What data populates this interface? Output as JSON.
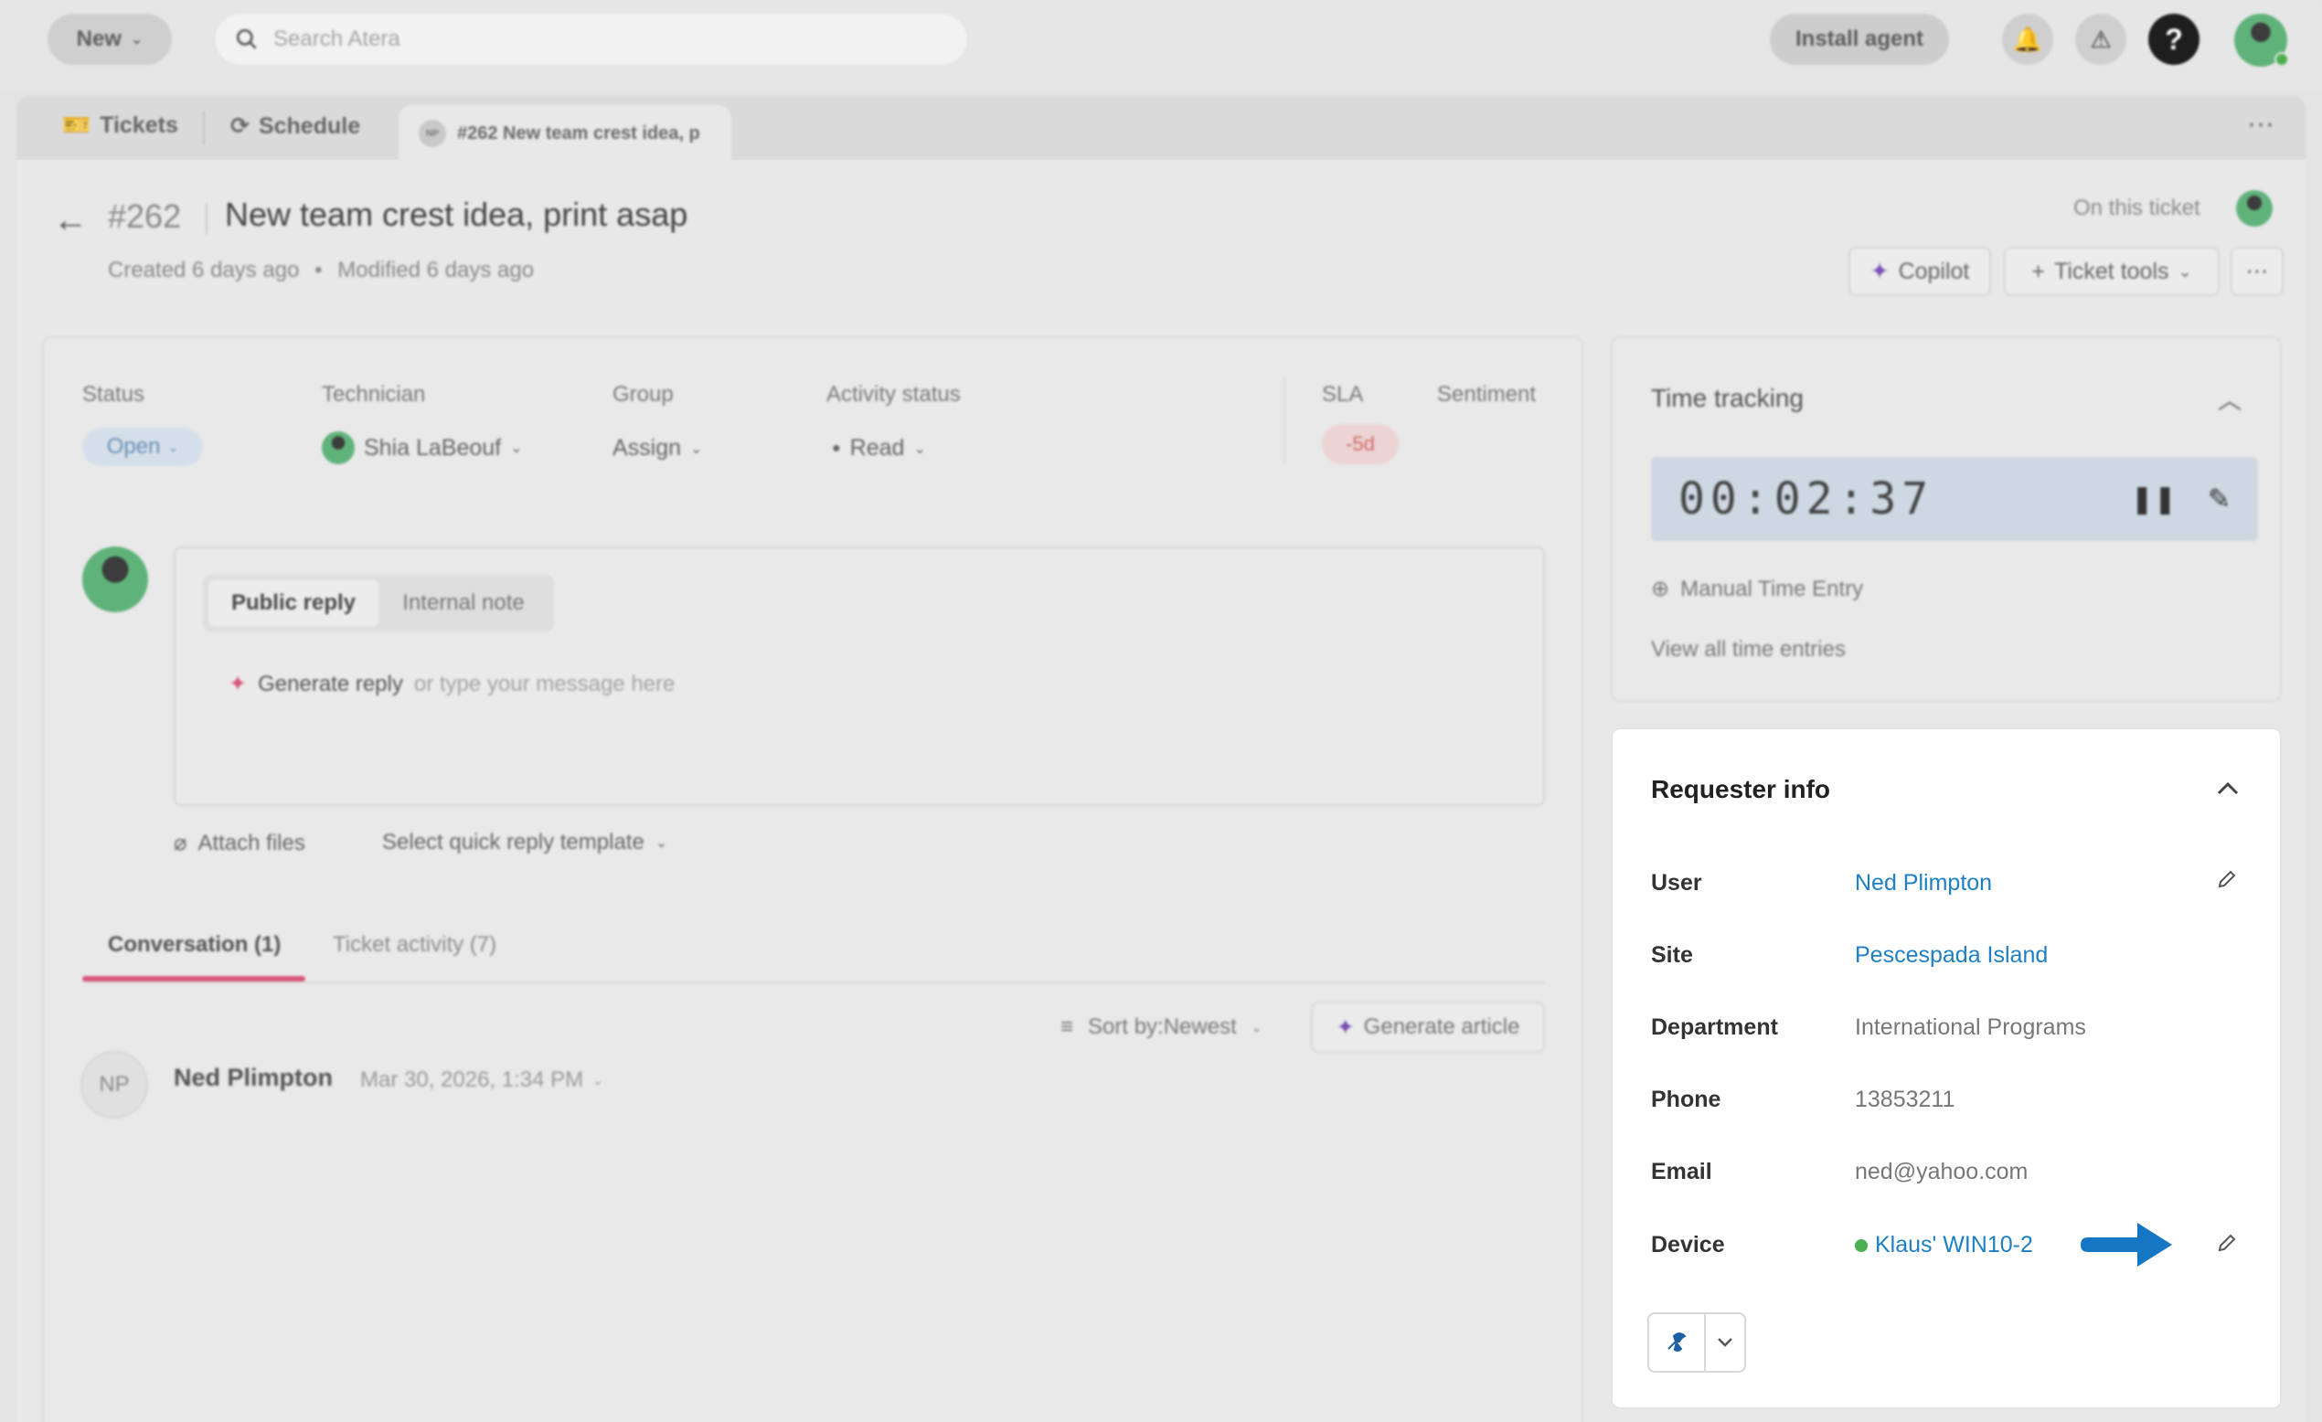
{
  "topbar": {
    "new_label": "New",
    "search_placeholder": "Search Atera",
    "install_label": "Install agent"
  },
  "tabs": {
    "tickets": "Tickets",
    "schedule": "Schedule",
    "active": "#262 New team crest idea, p",
    "active_avatar": "NP"
  },
  "ticket": {
    "number": "#262",
    "title": "New team crest idea, print asap",
    "created": "Created 6 days ago",
    "modified": "Modified 6 days ago",
    "on_this_ticket": "On this ticket",
    "copilot": "Copilot",
    "ticket_tools": "Ticket tools"
  },
  "fields": {
    "status_label": "Status",
    "status_value": "Open",
    "technician_label": "Technician",
    "technician_value": "Shia LaBeouf",
    "group_label": "Group",
    "group_value": "Assign",
    "activity_label": "Activity status",
    "activity_value": "Read",
    "sla_label": "SLA",
    "sla_value": "-5d",
    "sentiment_label": "Sentiment"
  },
  "reply": {
    "public": "Public reply",
    "internal": "Internal note",
    "generate": "Generate reply",
    "hint": "or type your message here",
    "attach": "Attach files",
    "template": "Select quick reply template"
  },
  "conversation": {
    "tab_conv": "Conversation (1)",
    "tab_activity": "Ticket activity (7)",
    "sort": "Sort by:Newest",
    "generate_article": "Generate article",
    "initials": "NP",
    "author": "Ned Plimpton",
    "date": "Mar 30, 2026, 1:34 PM"
  },
  "time_tracking": {
    "title": "Time tracking",
    "timer": "00:02:37",
    "manual": "Manual Time Entry",
    "view_all": "View all time entries"
  },
  "requester": {
    "title": "Requester info",
    "rows": [
      {
        "label": "User",
        "value": "Ned Plimpton"
      },
      {
        "label": "Site",
        "value": "Pescespada Island"
      },
      {
        "label": "Department",
        "value": "International Programs"
      },
      {
        "label": "Phone",
        "value": "13853211"
      },
      {
        "label": "Email",
        "value": "ned@yahoo.com"
      },
      {
        "label": "Device",
        "value": "Klaus' WIN10-2"
      }
    ]
  },
  "colors": {
    "link": "#1e7fc2",
    "arrow": "#1577c4",
    "online": "#4caf50",
    "accent_pink": "#d9567a"
  }
}
